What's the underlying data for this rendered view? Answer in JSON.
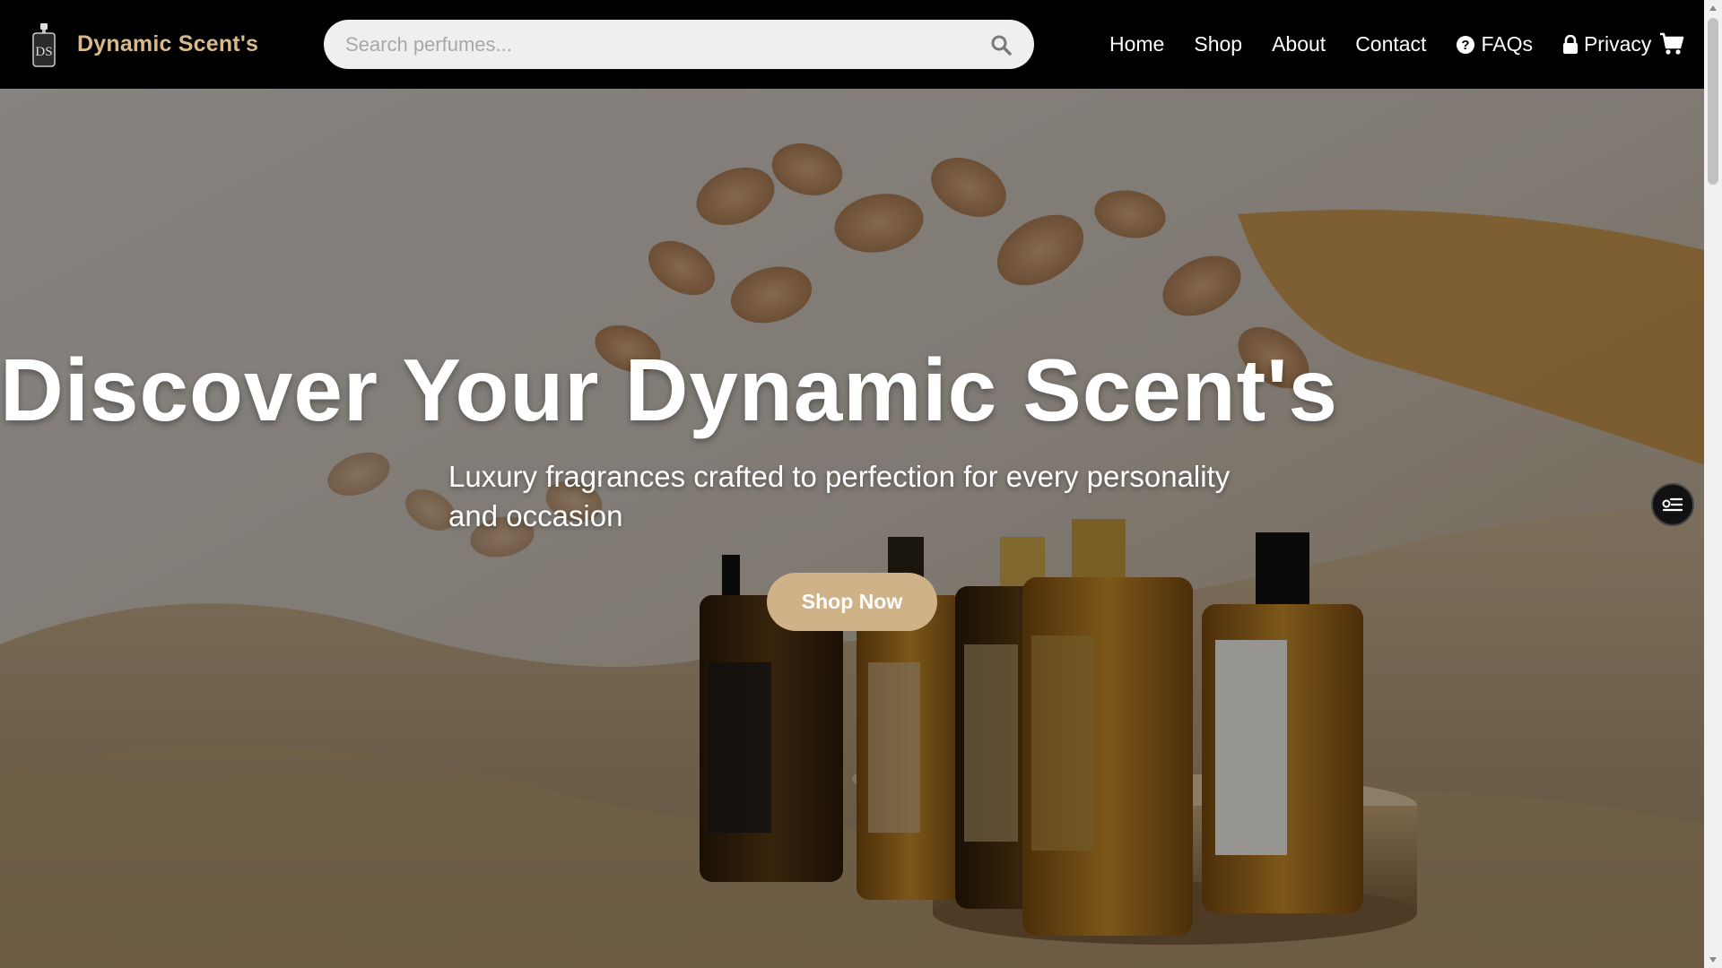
{
  "brand": {
    "name": "Dynamic Scent's",
    "color": "#d8b98a"
  },
  "search": {
    "placeholder": "Search perfumes..."
  },
  "nav": {
    "items": [
      {
        "label": "Home"
      },
      {
        "label": "Shop"
      },
      {
        "label": "About"
      },
      {
        "label": "Contact"
      },
      {
        "label": "FAQs",
        "icon": "question-circle-icon"
      },
      {
        "label": "Privacy",
        "icon": "lock-icon"
      }
    ],
    "cart_icon": "cart-icon"
  },
  "hero": {
    "title": "Discover Your Dynamic Scent's",
    "subtitle": "Luxury fragrances crafted to perfection for every personality and occasion",
    "cta": "Shop Now",
    "cta_color": "#d0b288"
  }
}
